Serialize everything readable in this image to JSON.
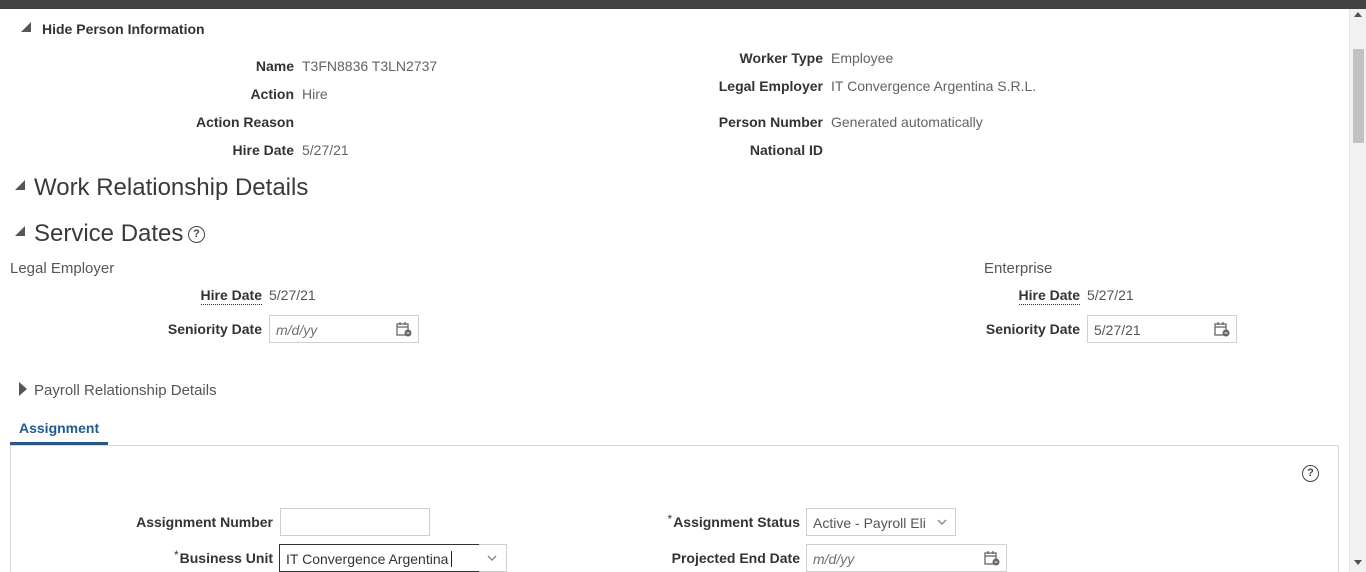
{
  "person_info": {
    "toggle_label": "Hide Person Information",
    "fields_left": [
      {
        "label": "Name",
        "value": "T3FN8836 T3LN2737"
      },
      {
        "label": "Action",
        "value": "Hire"
      },
      {
        "label": "Action Reason",
        "value": ""
      },
      {
        "label": "Hire Date",
        "value": "5/27/21"
      }
    ],
    "fields_right": [
      {
        "label": "Worker Type",
        "value": "Employee"
      },
      {
        "label": "Legal Employer",
        "value": "IT Convergence Argentina S.R.L."
      },
      {
        "label": "Person Number",
        "value": "Generated automatically"
      },
      {
        "label": "National ID",
        "value": ""
      }
    ]
  },
  "work_relationship": {
    "title": "Work Relationship Details"
  },
  "service_dates": {
    "title": "Service Dates",
    "help_glyph": "?",
    "legal_employer": {
      "heading": "Legal Employer",
      "hire_date_label": "Hire Date",
      "hire_date_value": "5/27/21",
      "seniority_label": "Seniority Date",
      "seniority_placeholder": "m/d/yy",
      "seniority_value": ""
    },
    "enterprise": {
      "heading": "Enterprise",
      "hire_date_label": "Hire Date",
      "hire_date_value": "5/27/21",
      "seniority_label": "Seniority Date",
      "seniority_value": "5/27/21"
    }
  },
  "payroll": {
    "title": "Payroll Relationship Details"
  },
  "assignment": {
    "tab_label": "Assignment",
    "help_glyph": "?",
    "required_mark": "*",
    "assignment_number_label": "Assignment Number",
    "assignment_number_value": "",
    "business_unit_label": "Business Unit",
    "business_unit_value": "IT Convergence Argentina",
    "assignment_status_label": "Assignment Status",
    "assignment_status_value": "Active - Payroll Eli",
    "projected_end_label": "Projected End Date",
    "projected_end_placeholder": "m/d/yy"
  },
  "colors": {
    "accent": "#1e5b96",
    "top_bar": "#424242"
  }
}
